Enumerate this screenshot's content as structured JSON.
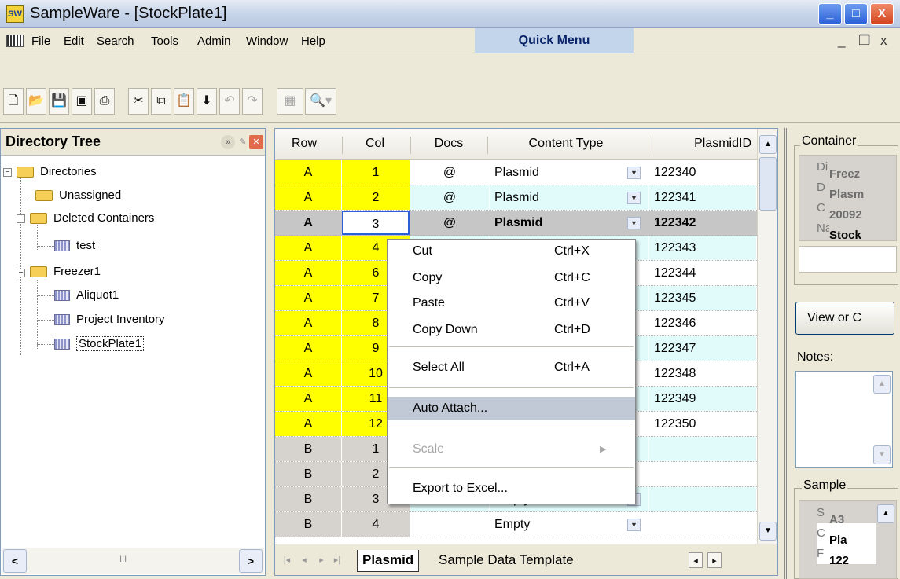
{
  "window": {
    "title": "SampleWare - [StockPlate1]",
    "app_icon": "SW",
    "minimize_label": "_",
    "maximize_label": "□",
    "close_label": "X"
  },
  "menu": {
    "items": [
      "File",
      "Edit",
      "Search",
      "Tools",
      "Admin",
      "Window",
      "Help"
    ],
    "quick_menu": "Quick Menu",
    "mdi_minimize": "_",
    "mdi_restore": "❐",
    "mdi_close": "x"
  },
  "toolbar": {
    "buttons": [
      "new-icon",
      "open-icon",
      "save-icon",
      "save-all-icon",
      "print-icon",
      "cut-icon",
      "copy-icon",
      "paste-icon",
      "fill-down-icon",
      "undo-icon",
      "redo-icon",
      "grid-view-icon",
      "search-icon"
    ]
  },
  "tree": {
    "title": "Directory Tree",
    "root": "Directories",
    "nodes": [
      "Unassigned",
      "Deleted Containers",
      "test",
      "Freezer1",
      "Aliquot1",
      "Project Inventory",
      "StockPlate1"
    ],
    "scroll_grip": "III"
  },
  "grid": {
    "columns": [
      "Row",
      "Col",
      "Docs",
      "Content Type",
      "PlasmidID"
    ],
    "rows": [
      {
        "row": "A",
        "col": "1",
        "docs": "@",
        "type": "Plasmid",
        "id": "122340"
      },
      {
        "row": "A",
        "col": "2",
        "docs": "@",
        "type": "Plasmid",
        "id": "122341"
      },
      {
        "row": "A",
        "col": "3",
        "docs": "@",
        "type": "Plasmid",
        "id": "122342"
      },
      {
        "row": "A",
        "col": "4",
        "docs": "",
        "type": "",
        "id": "122343"
      },
      {
        "row": "A",
        "col": "6",
        "docs": "",
        "type": "",
        "id": "122344"
      },
      {
        "row": "A",
        "col": "7",
        "docs": "",
        "type": "",
        "id": "122345"
      },
      {
        "row": "A",
        "col": "8",
        "docs": "",
        "type": "",
        "id": "122346"
      },
      {
        "row": "A",
        "col": "9",
        "docs": "",
        "type": "",
        "id": "122347"
      },
      {
        "row": "A",
        "col": "10",
        "docs": "",
        "type": "",
        "id": "122348"
      },
      {
        "row": "A",
        "col": "11",
        "docs": "",
        "type": "",
        "id": "122349"
      },
      {
        "row": "A",
        "col": "12",
        "docs": "",
        "type": "",
        "id": "122350"
      },
      {
        "row": "B",
        "col": "1",
        "docs": "",
        "type": "",
        "id": ""
      },
      {
        "row": "B",
        "col": "2",
        "docs": "",
        "type": "",
        "id": ""
      },
      {
        "row": "B",
        "col": "3",
        "docs": "",
        "type": "Empty",
        "id": ""
      },
      {
        "row": "B",
        "col": "4",
        "docs": "",
        "type": "Empty",
        "id": ""
      }
    ],
    "tabs": [
      "Plasmid",
      "Sample Data Template"
    ],
    "colors": {
      "yellow": "#ffff00",
      "cyan": "#e1fafa",
      "gray": "#d6d3ce",
      "selected": "#c6c6c6"
    }
  },
  "context_menu": {
    "items": [
      {
        "label": "Cut",
        "shortcut": "Ctrl+X"
      },
      {
        "label": "Copy",
        "shortcut": "Ctrl+C"
      },
      {
        "label": "Paste",
        "shortcut": "Ctrl+V"
      },
      {
        "label": "Copy Down",
        "shortcut": "Ctrl+D"
      },
      {
        "label": "Select All",
        "shortcut": "Ctrl+A"
      },
      {
        "label": "Auto Attach...",
        "shortcut": ""
      },
      {
        "label": "Scale",
        "shortcut": ""
      },
      {
        "label": "Export to Excel...",
        "shortcut": ""
      }
    ]
  },
  "right_panel": {
    "container_title": "Container",
    "container_rows": [
      {
        "key": "Di",
        "value": "Freez"
      },
      {
        "key": "D",
        "value": "Plasm"
      },
      {
        "key": "C",
        "value": "20092"
      },
      {
        "key": "Na",
        "value": "Stock"
      }
    ],
    "view_button": "View or C",
    "notes_label": "Notes:",
    "sample_title": "Sample",
    "sample_rows": [
      {
        "key": "S",
        "value": "A3"
      },
      {
        "key": "C",
        "value": "Pla"
      },
      {
        "key": "F",
        "value": "122"
      }
    ]
  }
}
